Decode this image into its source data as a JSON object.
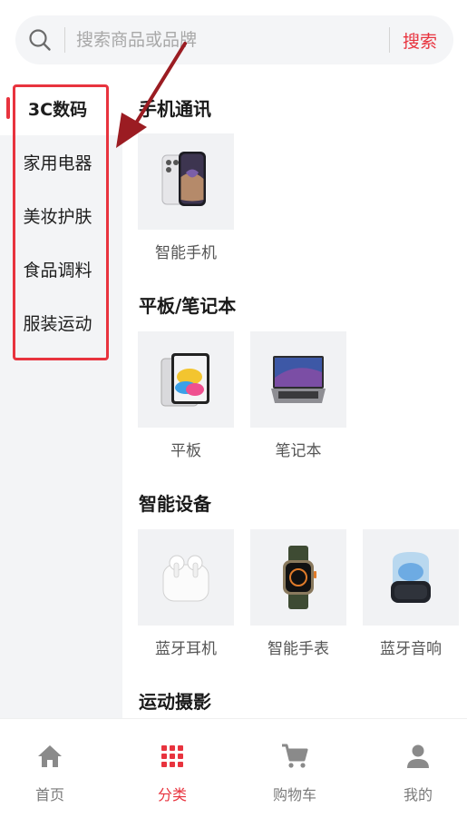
{
  "search": {
    "placeholder": "搜索商品或品牌",
    "button": "搜索"
  },
  "sidebar": {
    "items": [
      {
        "label": "3C数码"
      },
      {
        "label": "家用电器"
      },
      {
        "label": "美妆护肤"
      },
      {
        "label": "食品调料"
      },
      {
        "label": "服装运动"
      }
    ]
  },
  "sections": [
    {
      "title": "手机通讯",
      "products": [
        {
          "label": "智能手机"
        }
      ]
    },
    {
      "title": "平板/笔记本",
      "products": [
        {
          "label": "平板"
        },
        {
          "label": "笔记本"
        }
      ]
    },
    {
      "title": "智能设备",
      "products": [
        {
          "label": "蓝牙耳机"
        },
        {
          "label": "智能手表"
        },
        {
          "label": "蓝牙音响"
        }
      ]
    },
    {
      "title": "运动摄影",
      "products": []
    }
  ],
  "tabbar": {
    "items": [
      {
        "label": "首页",
        "icon": "home-icon"
      },
      {
        "label": "分类",
        "icon": "grid-icon"
      },
      {
        "label": "购物车",
        "icon": "cart-icon"
      },
      {
        "label": "我的",
        "icon": "user-icon"
      }
    ]
  },
  "colors": {
    "accent": "#e8333e",
    "annotation": "#9b1c22"
  }
}
